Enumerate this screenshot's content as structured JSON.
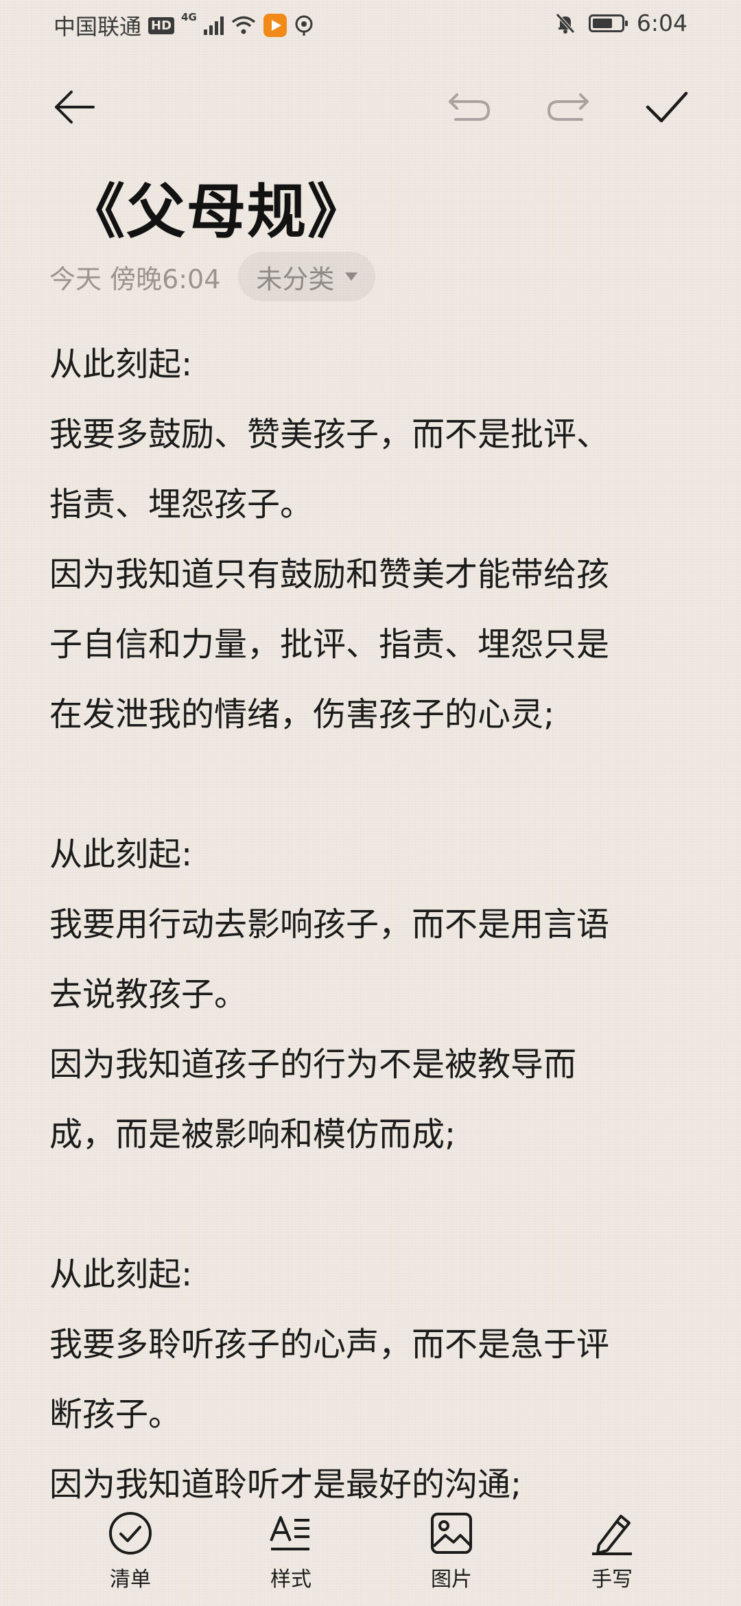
{
  "status_bar": {
    "carrier": "中国联通",
    "hd": "HD",
    "network": "4G",
    "time": "6:04"
  },
  "toolbar": {
    "back_icon": "arrow-left-icon",
    "undo_icon": "undo-icon",
    "redo_icon": "redo-icon",
    "confirm_icon": "checkmark-icon"
  },
  "note": {
    "title": "《父母规》",
    "timestamp": "今天 傍晚6:04",
    "category": "未分类",
    "body": "从此刻起:\n我要多鼓励、赞美孩子，而不是批评、\n指责、埋怨孩子。\n因为我知道只有鼓励和赞美才能带给孩\n子自信和力量，批评、指责、埋怨只是\n在发泄我的情绪，伤害孩子的心灵;\n\n从此刻起:\n我要用行动去影响孩子，而不是用言语\n去说教孩子。\n因为我知道孩子的行为不是被教导而\n成，而是被影响和模仿而成;\n\n从此刻起:\n我要多聆听孩子的心声，而不是急于评\n断孩子。\n因为我知道聆听才是最好的沟通;"
  },
  "bottom_bar": {
    "items": [
      {
        "label": "清单",
        "icon": "checklist-icon"
      },
      {
        "label": "样式",
        "icon": "text-style-icon"
      },
      {
        "label": "图片",
        "icon": "image-icon"
      },
      {
        "label": "手写",
        "icon": "pen-icon"
      }
    ]
  }
}
